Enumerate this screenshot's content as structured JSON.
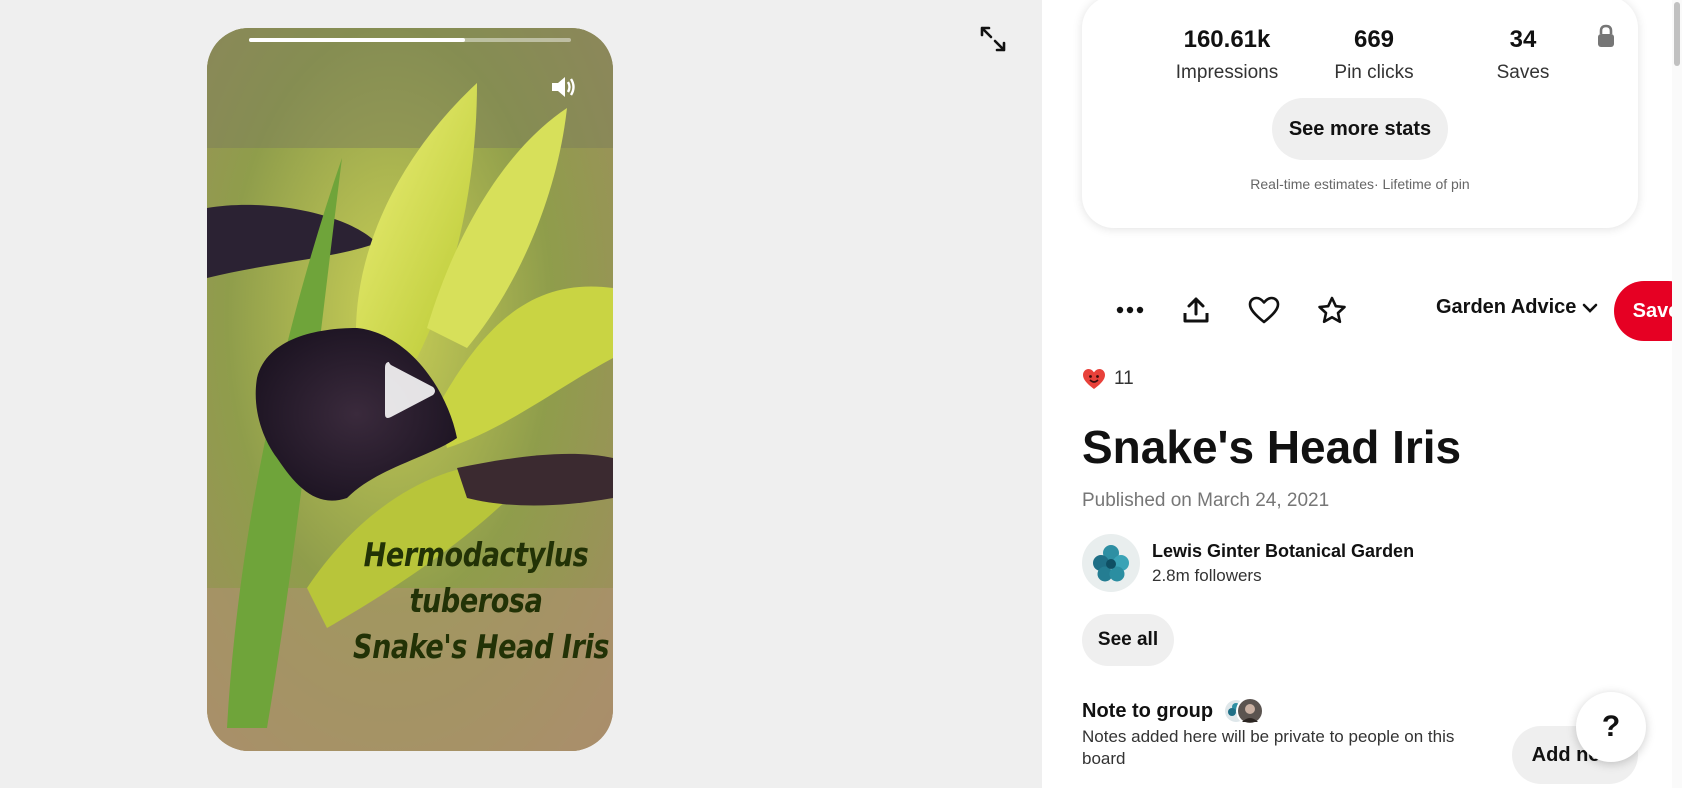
{
  "video": {
    "progress": 0.67,
    "caption_lines": [
      "Hermodactylus",
      "tuberosa",
      "Snake's Head Iris"
    ],
    "icons": {
      "volume": "volume-icon",
      "play": "play-icon",
      "expand": "expand-icon"
    }
  },
  "stats": {
    "impressions_value": "160.61k",
    "impressions_label": "Impressions",
    "pin_clicks_value": "669",
    "pin_clicks_label": "Pin clicks",
    "saves_value": "34",
    "saves_label": "Saves",
    "see_more_label": "See more stats",
    "note": "Real-time estimates· Lifetime of pin"
  },
  "actions": {
    "board_name": "Garden Advice",
    "save_label": "Save",
    "icons": [
      "more-icon",
      "share-icon",
      "heart-icon",
      "star-icon"
    ]
  },
  "reactions": {
    "count": "11"
  },
  "pin": {
    "title": "Snake's Head Iris",
    "published": "Published on March 24, 2021"
  },
  "creator": {
    "name": "Lewis Ginter Botanical Garden",
    "followers": "2.8m followers"
  },
  "see_all_label": "See all",
  "note": {
    "title": "Note to group",
    "description": "Notes added here will be private to people on this board",
    "add_label": "Add note"
  },
  "help_label": "?",
  "colors": {
    "save": "#e60023",
    "chip": "#efefef",
    "caption": "#223206"
  }
}
